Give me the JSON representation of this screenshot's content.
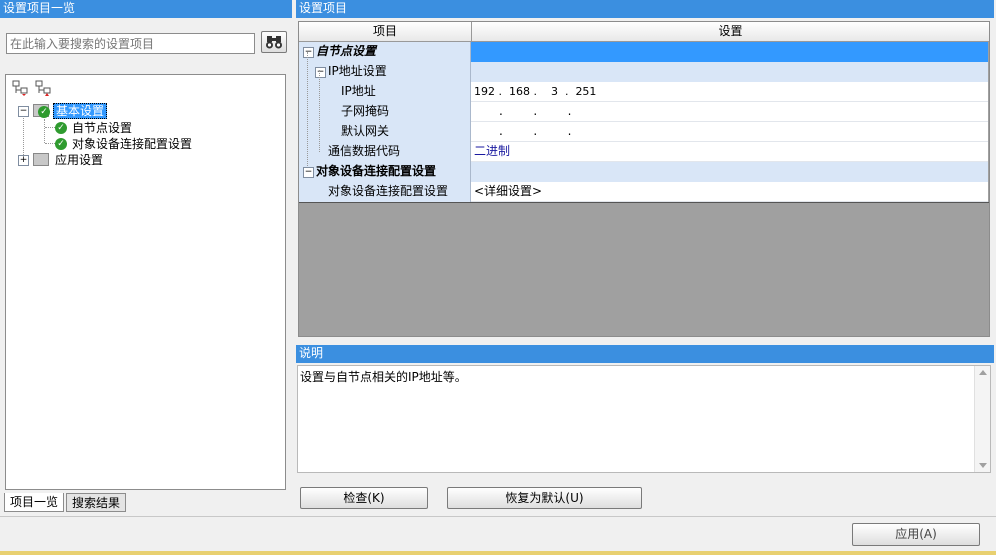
{
  "left_panel": {
    "title": "设置项目一览",
    "search_placeholder": "在此输入要搜索的设置项目",
    "tree": [
      {
        "label": "基本设置",
        "level": 0,
        "selected": true
      },
      {
        "label": "自节点设置",
        "level": 1
      },
      {
        "label": "对象设备连接配置设置",
        "level": 1
      },
      {
        "label": "应用设置",
        "level": 0
      }
    ],
    "tabs": [
      "项目一览",
      "搜索结果"
    ]
  },
  "right_panel": {
    "title": "设置项目",
    "columns": [
      "项目",
      "设置"
    ],
    "rows": {
      "self_node": {
        "label": "自节点设置",
        "value": ""
      },
      "ip_settings": {
        "label": "IP地址设置",
        "value": ""
      },
      "ip_address": {
        "label": "IP地址",
        "value": "192 .  168 .    3  .  251"
      },
      "subnet": {
        "label": "子网掩码",
        "value": ".        .        ."
      },
      "gateway": {
        "label": "默认网关",
        "value": ".        .        ."
      },
      "comm_code": {
        "label": "通信数据代码",
        "value": "二进制"
      },
      "target_conn": {
        "label": "对象设备连接配置设置",
        "value": ""
      },
      "target_conn_item": {
        "label": "对象设备连接配置设置",
        "value": "<详细设置>"
      }
    }
  },
  "description": {
    "title": "说明",
    "text": "设置与自节点相关的IP地址等。"
  },
  "buttons": {
    "check": "检查(K)",
    "restore": "恢复为默认(U)",
    "apply": "应用(A)"
  },
  "colors": {
    "title_bar": "#3b8fe0",
    "selected_row": "#3399ff",
    "section_bg": "#d9e6f7",
    "empty_area": "#a0a0a0"
  }
}
